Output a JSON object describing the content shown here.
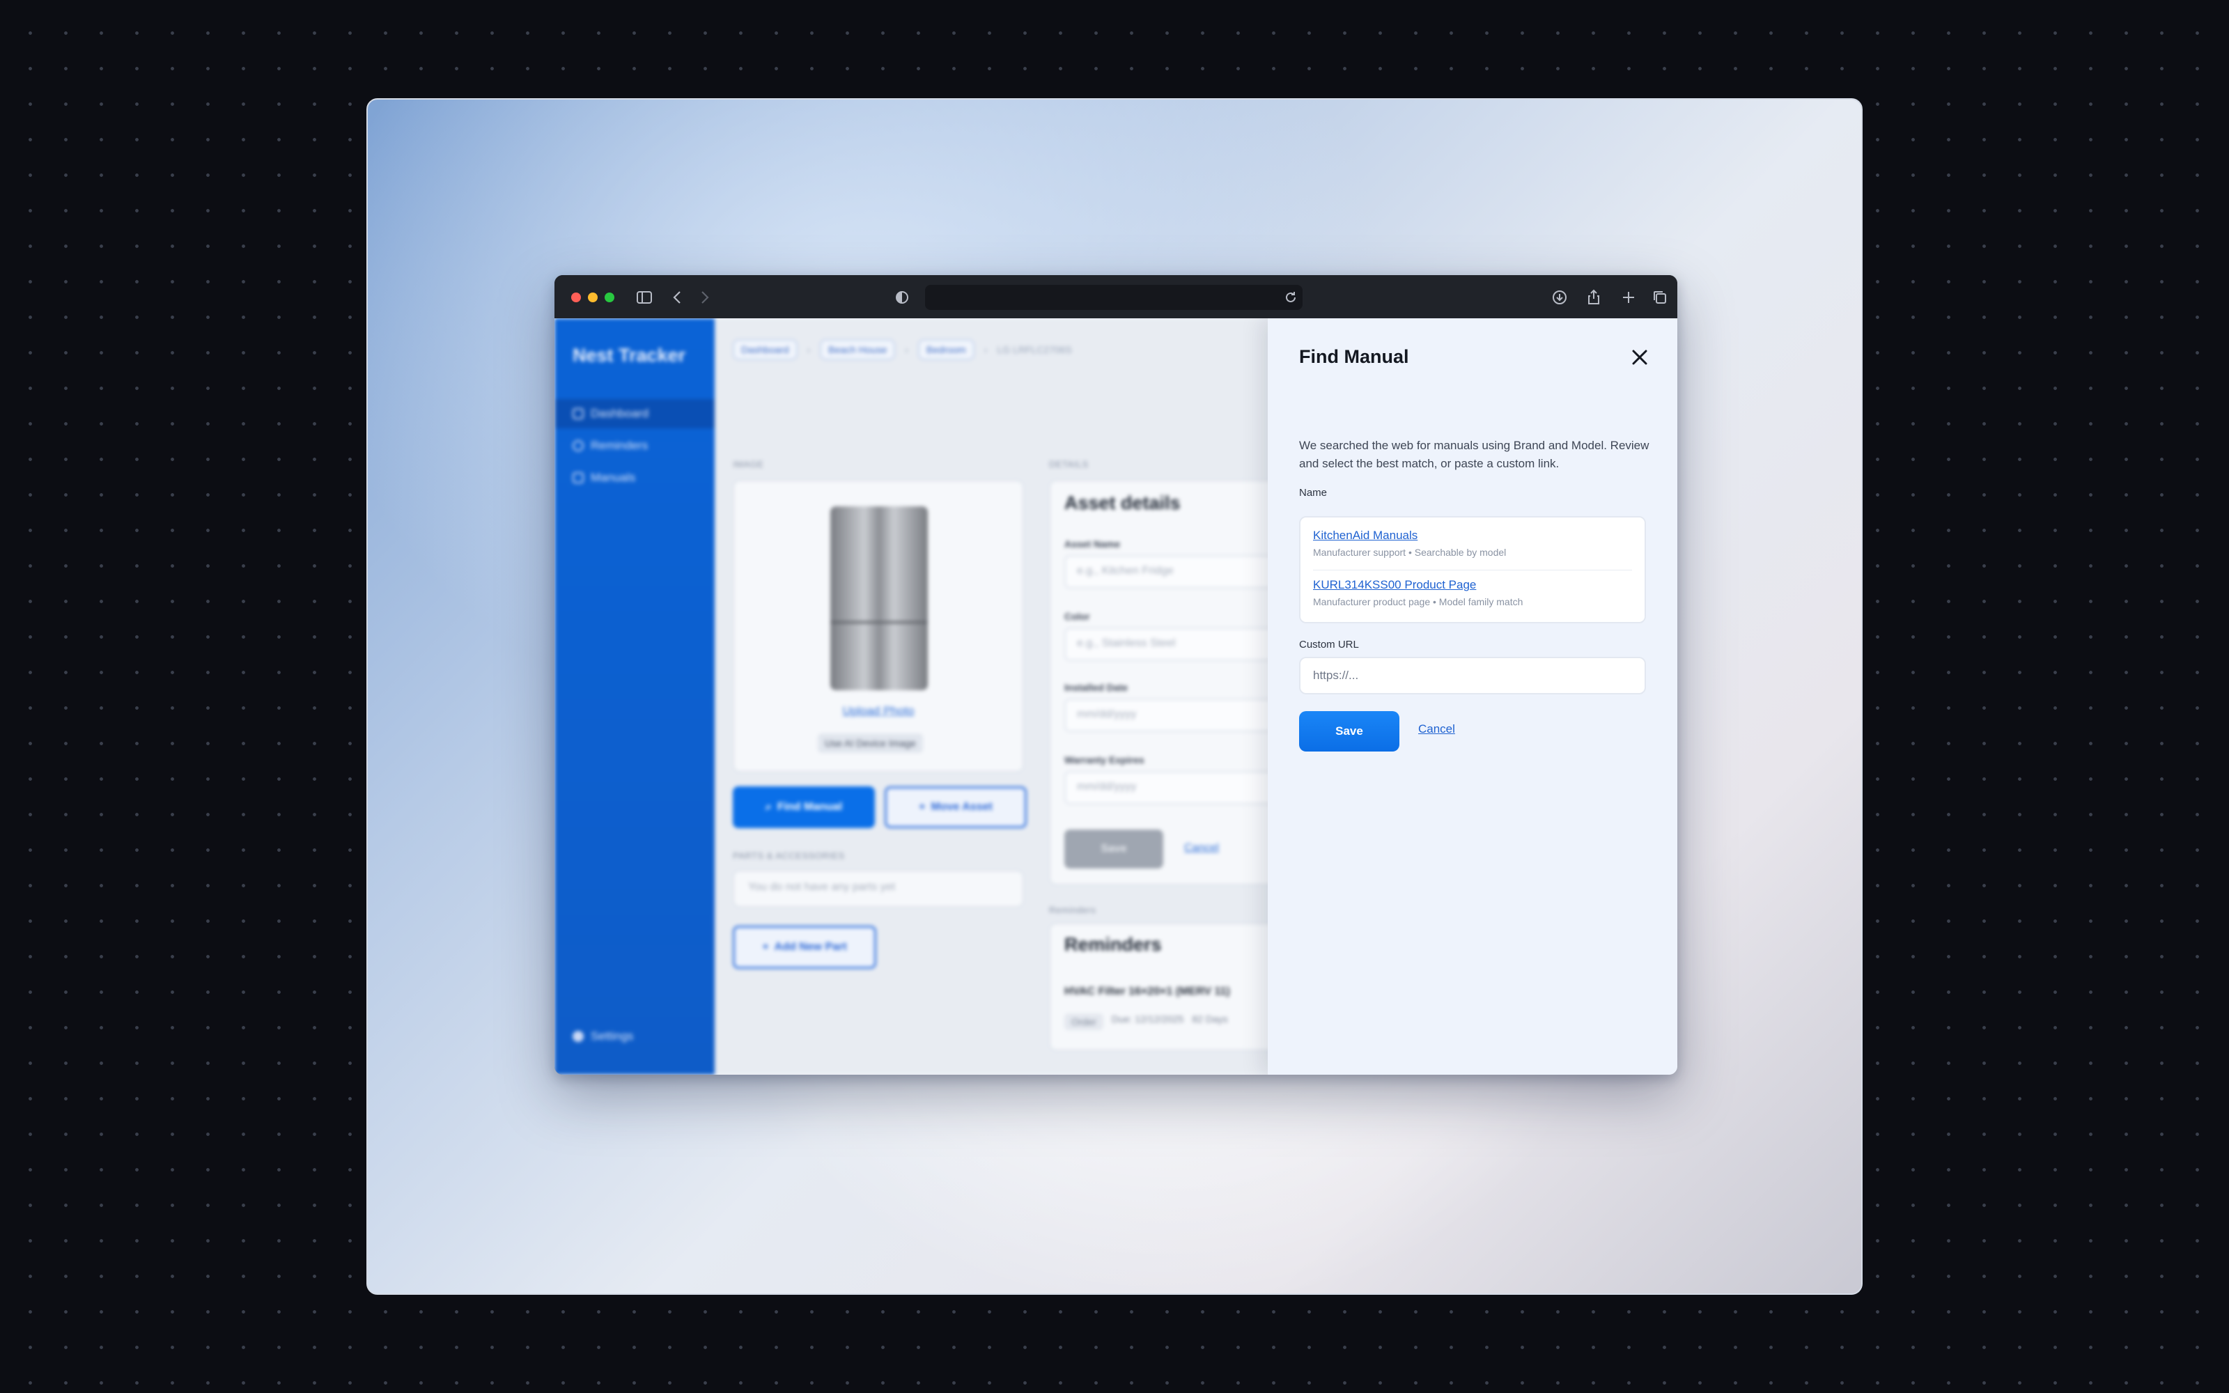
{
  "browser": {
    "address_text": ""
  },
  "app": {
    "brand": "Nest Tracker",
    "nav": [
      {
        "label": "Dashboard",
        "icon": "home-icon",
        "active": true
      },
      {
        "label": "Reminders",
        "icon": "bell-icon",
        "active": false
      },
      {
        "label": "Manuals",
        "icon": "book-icon",
        "active": false
      }
    ],
    "settings_label": "Settings",
    "breadcrumbs": [
      "Dashboard",
      "Beach House",
      "Bedroom"
    ],
    "breadcrumb_current": "LG LRFLC2706S",
    "image_section_label": "IMAGE",
    "details_section_label": "DETAILS",
    "upload_photo": "Upload Photo",
    "use_ai_image": "Use AI Device Image",
    "find_manual_button": "Find Manual",
    "move_asset_button": "Move Asset",
    "parts_section_label": "PARTS & ACCESSORIES",
    "parts_empty": "You do not have any parts yet",
    "add_part_button": "Add New Part",
    "asset_details_title": "Asset details",
    "fields": [
      {
        "label": "Asset Name",
        "placeholder": "e.g., Kitchen Fridge"
      },
      {
        "label": "Color",
        "placeholder": "e.g., Stainless Steel"
      },
      {
        "label": "Installed Date",
        "placeholder": "mm/dd/yyyy"
      },
      {
        "label": "Warranty Expires",
        "placeholder": "mm/dd/yyyy"
      }
    ],
    "details_save": "Save",
    "details_cancel": "Cancel",
    "reminders_section_label": "Reminders",
    "reminders_title": "Reminders",
    "reminder_item": "HVAC Filter 16×20×1 (MERV 11)",
    "reminder_order": "Order",
    "reminder_due": "Due: 12/12/2025",
    "reminder_days": "82 Days"
  },
  "drawer": {
    "title": "Find Manual",
    "description": "We searched the web for manuals using Brand and Model. Review and select the best match, or paste a custom link.",
    "name_label": "Name",
    "results": [
      {
        "title": "KitchenAid Manuals",
        "meta": "Manufacturer support • Searchable by model"
      },
      {
        "title": "KURL314KSS00 Product Page",
        "meta": "Manufacturer product page • Model family match"
      }
    ],
    "custom_url_label": "Custom URL",
    "custom_url_placeholder": "https://...",
    "custom_url_value": "",
    "save_label": "Save",
    "cancel_label": "Cancel"
  },
  "colors": {
    "accent": "#0b6ee6",
    "sidebar": "#0b63d6",
    "link": "#1f62d1"
  }
}
